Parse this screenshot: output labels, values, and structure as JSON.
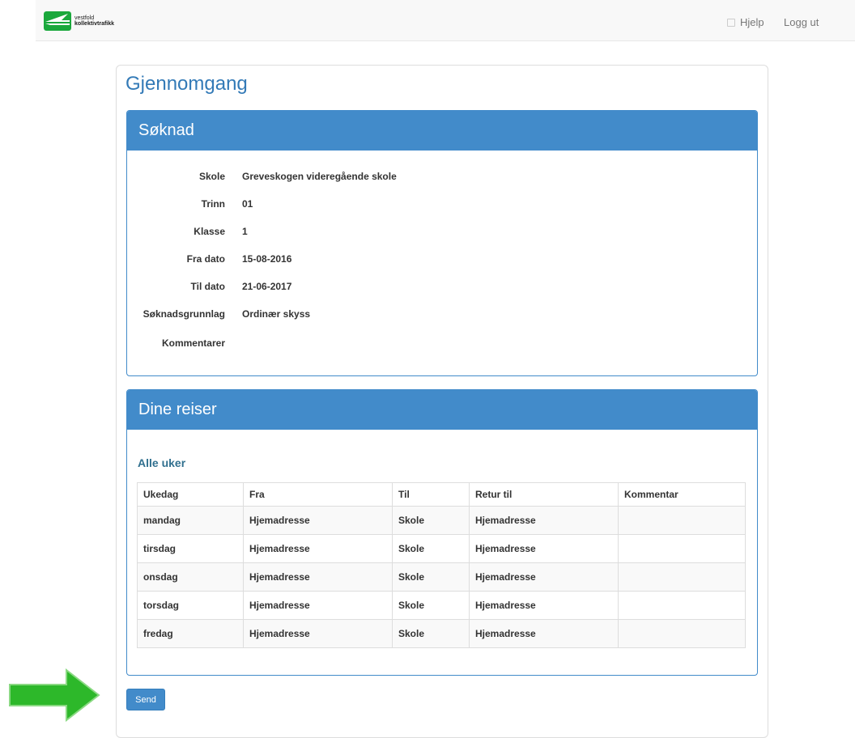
{
  "header": {
    "logo_line1": "vestfold",
    "logo_line2": "kollektivtrafikk",
    "help_label": "Hjelp",
    "logout_label": "Logg ut"
  },
  "page": {
    "title": "Gjennomgang"
  },
  "soknad": {
    "heading": "Søknad",
    "fields": [
      {
        "label": "Skole",
        "value": "Greveskogen videregående skole"
      },
      {
        "label": "Trinn",
        "value": "01"
      },
      {
        "label": "Klasse",
        "value": "1"
      },
      {
        "label": "Fra dato",
        "value": "15-08-2016"
      },
      {
        "label": "Til dato",
        "value": "21-06-2017"
      },
      {
        "label": "Søknadsgrunnlag",
        "value": "Ordinær skyss"
      },
      {
        "label": "Kommentarer",
        "value": ""
      }
    ]
  },
  "reiser": {
    "heading": "Dine reiser",
    "section_title": "Alle uker",
    "columns": [
      "Ukedag",
      "Fra",
      "Til",
      "Retur til",
      "Kommentar"
    ],
    "rows": [
      [
        "mandag",
        "Hjemadresse",
        "Skole",
        "Hjemadresse",
        ""
      ],
      [
        "tirsdag",
        "Hjemadresse",
        "Skole",
        "Hjemadresse",
        ""
      ],
      [
        "onsdag",
        "Hjemadresse",
        "Skole",
        "Hjemadresse",
        ""
      ],
      [
        "torsdag",
        "Hjemadresse",
        "Skole",
        "Hjemadresse",
        ""
      ],
      [
        "fredag",
        "Hjemadresse",
        "Skole",
        "Hjemadresse",
        ""
      ]
    ]
  },
  "actions": {
    "send_label": "Send"
  },
  "colors": {
    "brand": "#428bca",
    "logo_green": "#1aa83c",
    "arrow_green": "#2db82a"
  },
  "icons": {
    "help": "help-icon",
    "arrow": "arrow-right-icon"
  }
}
